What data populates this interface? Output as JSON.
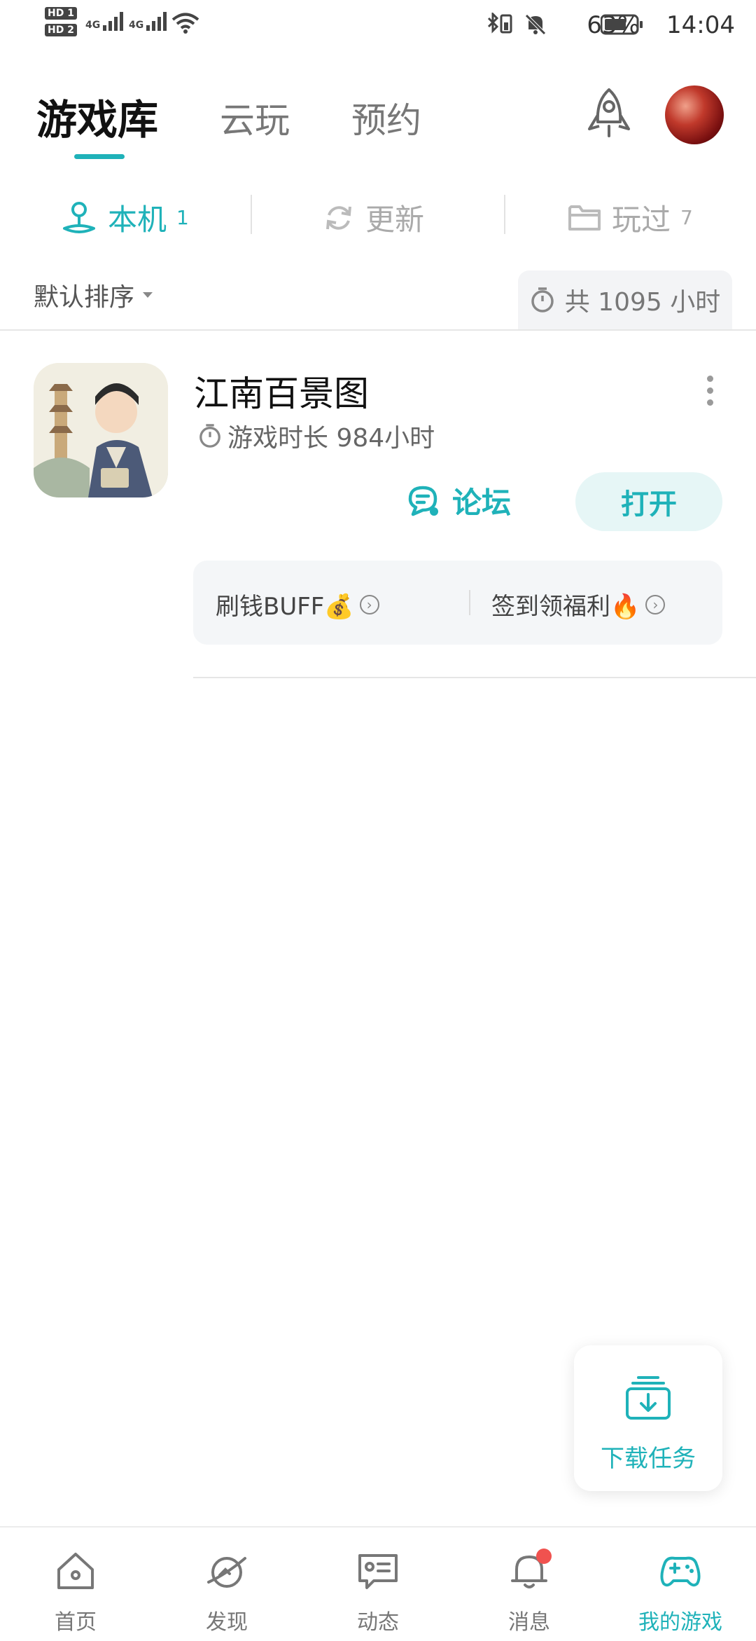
{
  "status_bar": {
    "sim1": "HD 1",
    "sim2": "HD 2",
    "net1": "4G",
    "net2": "4G",
    "battery_percent": "63%",
    "time": "14:04"
  },
  "header": {
    "tabs": [
      {
        "label": "游戏库",
        "active": true
      },
      {
        "label": "云玩",
        "active": false
      },
      {
        "label": "预约",
        "active": false
      }
    ],
    "icons": [
      "rocket-icon",
      "avatar"
    ]
  },
  "filter_tabs": [
    {
      "label": "本机",
      "count": "1",
      "icon": "joystick-icon",
      "active": true
    },
    {
      "label": "更新",
      "count": "",
      "icon": "refresh-icon",
      "active": false
    },
    {
      "label": "玩过",
      "count": "7",
      "icon": "folder-icon",
      "active": false
    }
  ],
  "sort": {
    "label": "默认排序",
    "total_playtime": "共 1095 小时"
  },
  "games": [
    {
      "title": "江南百景图",
      "playtime": "游戏时长 984小时",
      "forum_label": "论坛",
      "open_label": "打开",
      "promos": [
        {
          "label": "刷钱BUFF💰"
        },
        {
          "label": "签到领福利🔥"
        }
      ]
    }
  ],
  "download": {
    "label": "下载任务"
  },
  "bottom_nav": [
    {
      "label": "首页",
      "icon": "home-icon",
      "active": false
    },
    {
      "label": "发现",
      "icon": "planet-icon",
      "active": false
    },
    {
      "label": "动态",
      "icon": "feed-icon",
      "active": false
    },
    {
      "label": "消息",
      "icon": "bell-icon",
      "active": false,
      "badge": true
    },
    {
      "label": "我的游戏",
      "icon": "gamepad-icon",
      "active": true
    }
  ],
  "colors": {
    "accent": "#1fb2b9",
    "badge": "#f0524f",
    "text_primary": "#111111",
    "text_secondary": "#777777"
  }
}
